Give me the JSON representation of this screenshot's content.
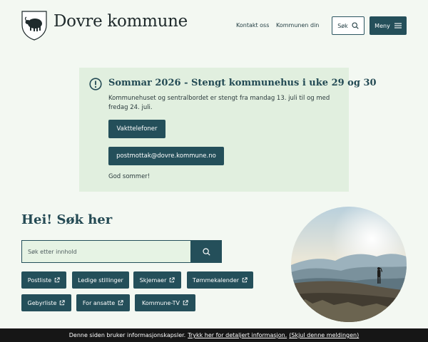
{
  "header": {
    "brand": "Dovre kommune",
    "nav": {
      "contact": "Kontakt oss",
      "municipality": "Kommunen din"
    },
    "search_label": "Søk",
    "menu_label": "Meny"
  },
  "notice": {
    "title": "Sommar 2026 - Stengt kommunehus i uke 29 og 30",
    "body": "Kommunehuset og sentralbordet er stengt fra mandag 13. juli til og med fredag 24. juli.",
    "duty_button": "Vakttelefoner",
    "email_button": "postmottak@dovre.kommune.no",
    "footer": "God sommer!"
  },
  "search": {
    "heading": "Hei! Søk her",
    "placeholder": "Søk etter innhold"
  },
  "quick_links": [
    {
      "label": "Postliste"
    },
    {
      "label": "Ledige stillinger"
    },
    {
      "label": "Skjemaer"
    },
    {
      "label": "Tømmekalender"
    },
    {
      "label": "Gebyrliste"
    },
    {
      "label": "For ansatte"
    },
    {
      "label": "Kommune-TV"
    }
  ],
  "cookie": {
    "text": "Denne siden bruker informasjonskapsler.",
    "details_link": "Trykk her for detaljert informasjon.",
    "hide_link": "(Skjul denne meldingen)"
  },
  "colors": {
    "accent": "#244f5a",
    "background": "#f3f8f2",
    "notice_bg": "#e1efdf",
    "cookie_bg": "#161616"
  },
  "icons": {
    "logo": "coat-of-arms-icon",
    "search": "search-icon",
    "menu": "hamburger-icon",
    "notice": "exclamation-circle-icon",
    "external": "external-link-icon"
  }
}
